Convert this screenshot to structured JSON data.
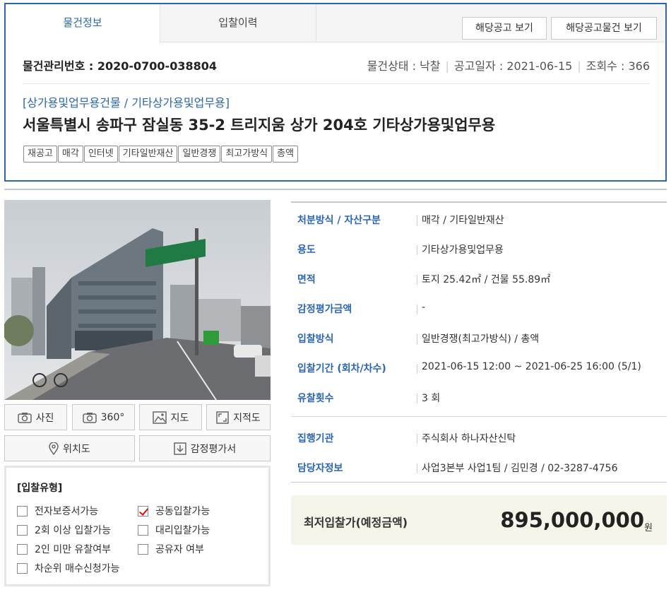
{
  "tabs": [
    {
      "label": "물건정보",
      "active": true
    },
    {
      "label": "입찰이력",
      "active": false
    }
  ],
  "tab_buttons": {
    "notice": "해당공고 보기",
    "notice_items": "해당공고물건 보기"
  },
  "item": {
    "mgmt_label": "물건관리번호 : 2020-0700-038804",
    "status": "물건상태 : 낙찰",
    "notice_date": "공고일자 : 2021-06-15",
    "views": "조회수 : 366",
    "category": "[상가용및업무용건물 / 기타상가용및업무용]",
    "title": "서울특별시 송파구 잠실동 35-2 트리지움 상가 204호 기타상가용및업무용",
    "badges": [
      "재공고",
      "매각",
      "인터넷",
      "기타일반재산",
      "일반경쟁",
      "최고가방식",
      "총액"
    ]
  },
  "photo_buttons": {
    "photo": "사진",
    "view360": "360°",
    "map": "지도",
    "cadastral": "지적도",
    "location": "위치도",
    "appraisal": "감정평가서"
  },
  "bid_type": {
    "title": "[입찰유형]",
    "options": [
      {
        "label": "전자보증서가능",
        "checked": false
      },
      {
        "label": "공동입찰가능",
        "checked": true
      },
      {
        "label": "2회 이상 입찰가능",
        "checked": false
      },
      {
        "label": "대리입찰가능",
        "checked": false
      },
      {
        "label": "2인 미만 유찰여부",
        "checked": false
      },
      {
        "label": "공유자 여부",
        "checked": false
      },
      {
        "label": "차순위 매수신청가능",
        "checked": false
      }
    ]
  },
  "info": [
    {
      "label": "처분방식 / 자산구분",
      "value": "매각 / 기타일반재산"
    },
    {
      "label": "용도",
      "value": "기타상가용및업무용"
    },
    {
      "label": "면적",
      "value": "토지 25.42㎡ / 건물 55.89㎡"
    },
    {
      "label": "감정평가금액",
      "value": "-"
    },
    {
      "label": "입찰방식",
      "value": "일반경쟁(최고가방식) / 총액"
    },
    {
      "label": "입찰기간 (회차/차수)",
      "value": "2021-06-15 12:00 ~ 2021-06-25 16:00 (5/1)"
    },
    {
      "label": "유찰횟수",
      "value": "3 회"
    },
    {
      "label": "집행기관",
      "value": "주식회사 하나자산신탁"
    },
    {
      "label": "담당자정보",
      "value": "사업3본부 사업1팀 / 김민경 / 02-3287-4756"
    }
  ],
  "price": {
    "label": "최저입찰가(예정금액)",
    "value": "895,000,000",
    "unit": "원"
  },
  "colors": {
    "accent": "#2b67b3",
    "check": "#dd1111",
    "price_bg": "#f7f4ea"
  }
}
